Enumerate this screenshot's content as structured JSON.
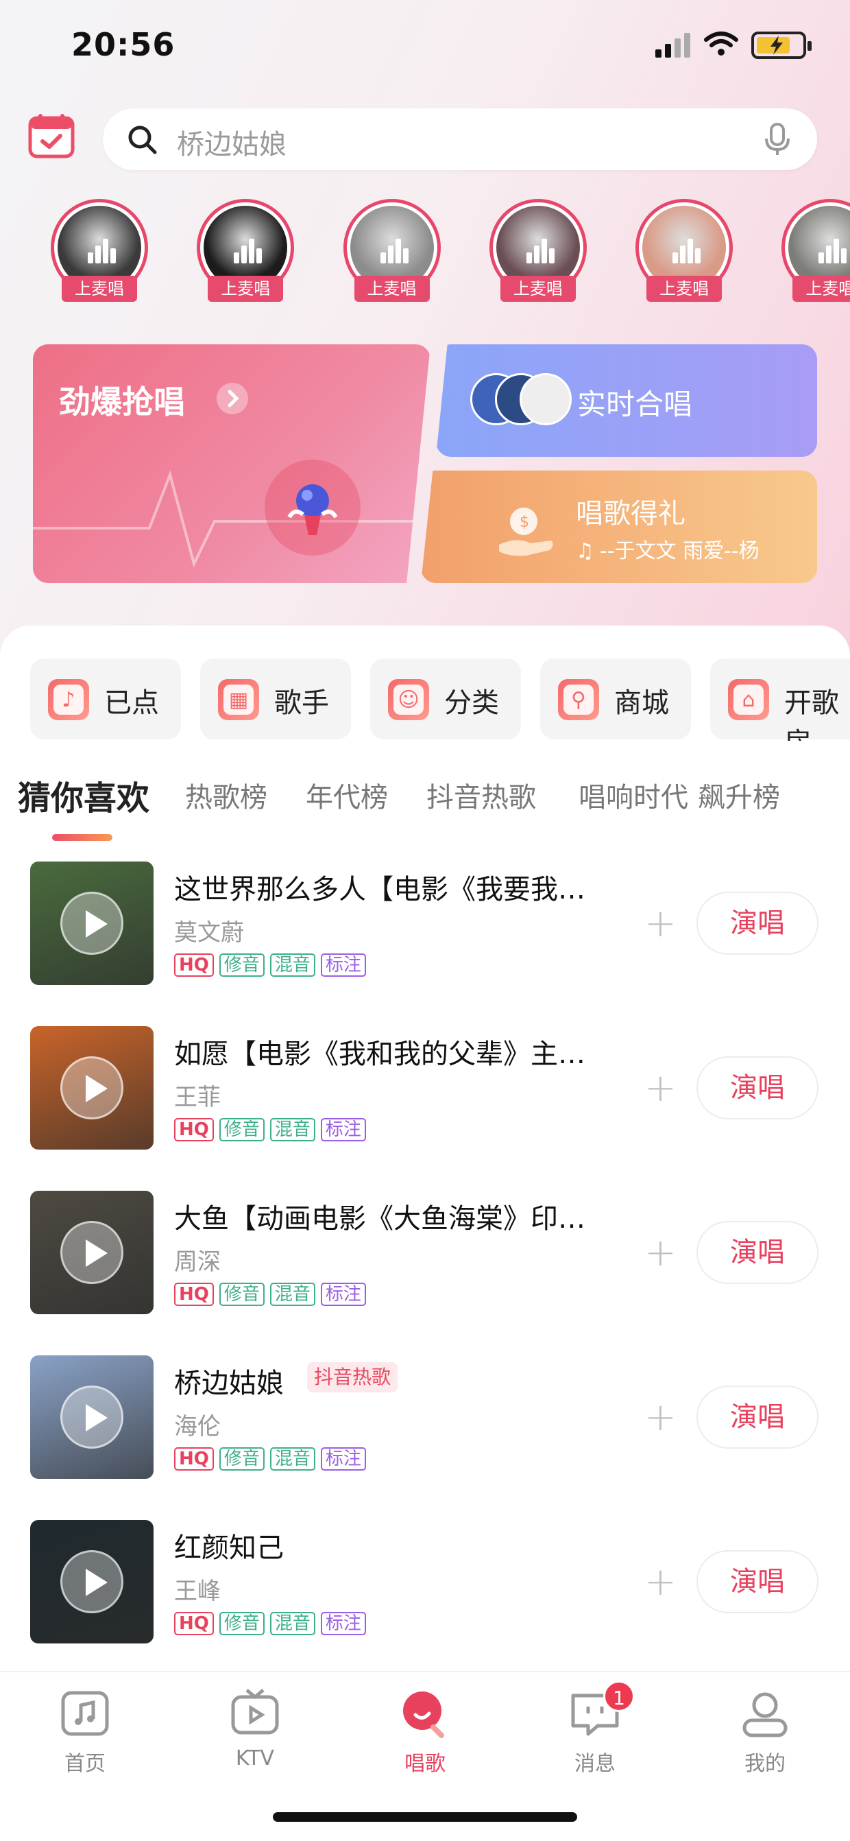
{
  "status_bar": {
    "time": "20:56"
  },
  "search": {
    "placeholder": "桥边姑娘"
  },
  "avatars": [
    {
      "tag": "上麦唱",
      "bg": "#3a3a3a"
    },
    {
      "tag": "上麦唱",
      "bg": "#1c1c1c"
    },
    {
      "tag": "上麦唱",
      "bg": "#8c8c8c"
    },
    {
      "tag": "上麦唱",
      "bg": "#6a4e55"
    },
    {
      "tag": "上麦唱",
      "bg": "#d99a86"
    },
    {
      "tag": "上麦唱",
      "bg": "#7c7c78"
    }
  ],
  "banners": {
    "main": {
      "title": "劲爆抢唱"
    },
    "chorus": {
      "title": "实时合唱"
    },
    "gift": {
      "title": "唱歌得礼",
      "subtitle": "--于文文  雨爱--杨"
    }
  },
  "quick_entries": [
    {
      "label": "已点",
      "icon": "music-note-icon"
    },
    {
      "label": "歌手",
      "icon": "grid-icon"
    },
    {
      "label": "分类",
      "icon": "category-icon"
    },
    {
      "label": "商城",
      "icon": "mic-shop-icon"
    },
    {
      "label": "开歌房",
      "icon": "house-icon"
    }
  ],
  "tabs": [
    "猜你喜欢",
    "热歌榜",
    "年代榜",
    "抖音热歌",
    "唱响时代",
    "飙升榜"
  ],
  "songs": [
    {
      "title": "这世界那么多人【电影《我要我…",
      "artist": "莫文蔚",
      "hot": "",
      "tags": [
        "HQ",
        "修音",
        "混音",
        "标注"
      ],
      "cover": "#4a6b3e"
    },
    {
      "title": "如愿【电影《我和我的父辈》主…",
      "artist": "王菲",
      "hot": "",
      "tags": [
        "HQ",
        "修音",
        "混音",
        "标注"
      ],
      "cover": "#c9642a"
    },
    {
      "title": "大鱼【动画电影《大鱼海棠》印…",
      "artist": "周深",
      "hot": "",
      "tags": [
        "HQ",
        "修音",
        "混音",
        "标注"
      ],
      "cover": "#4e4a42"
    },
    {
      "title": "桥边姑娘",
      "artist": "海伦",
      "hot": "抖音热歌",
      "tags": [
        "HQ",
        "修音",
        "混音",
        "标注"
      ],
      "cover": "#8aa2c6"
    },
    {
      "title": "红颜知己",
      "artist": "王峰",
      "hot": "",
      "tags": [
        "HQ",
        "修音",
        "混音",
        "标注"
      ],
      "cover": "#1f2a2e"
    }
  ],
  "sing_label": "演唱",
  "tabbar": [
    {
      "label": "首页",
      "icon": "music-home-icon"
    },
    {
      "label": "KTV",
      "icon": "tv-icon"
    },
    {
      "label": "唱歌",
      "icon": "sing-icon",
      "active": true
    },
    {
      "label": "消息",
      "icon": "message-icon",
      "badge": "1"
    },
    {
      "label": "我的",
      "icon": "profile-icon"
    }
  ]
}
